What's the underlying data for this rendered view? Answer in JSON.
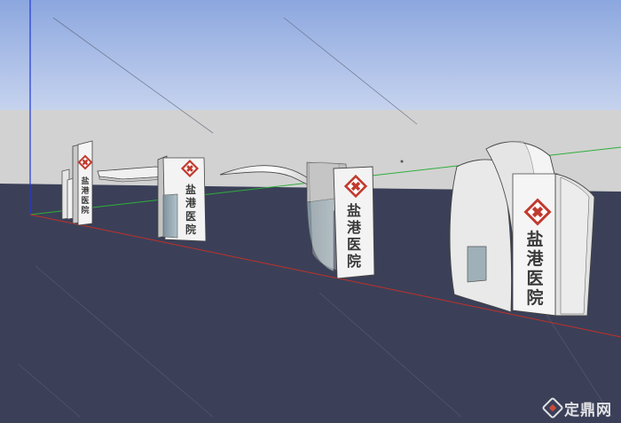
{
  "colors": {
    "sky": "#9fb9e6",
    "horizon": "#d2d2d2",
    "ground": "#3b4058",
    "sign_face": "#f2f2f2",
    "sign_side": "#c9c9c9",
    "glass": "#8fa3ad",
    "cross_red": "#c23a2e",
    "axis_red": "#c2302a",
    "axis_green": "#2fae3a",
    "axis_blue": "#2238d6"
  },
  "signs": {
    "gate1": {
      "text": [
        "盐",
        "港",
        "医",
        "院"
      ]
    },
    "gate2": {
      "text": [
        "盐",
        "港",
        "医",
        "院"
      ]
    },
    "gate3": {
      "text": [
        "盐",
        "港",
        "医",
        "院"
      ]
    },
    "gate4": {
      "text": [
        "盐",
        "港",
        "医",
        "院"
      ]
    }
  },
  "watermark": {
    "text": "定鼎网"
  }
}
